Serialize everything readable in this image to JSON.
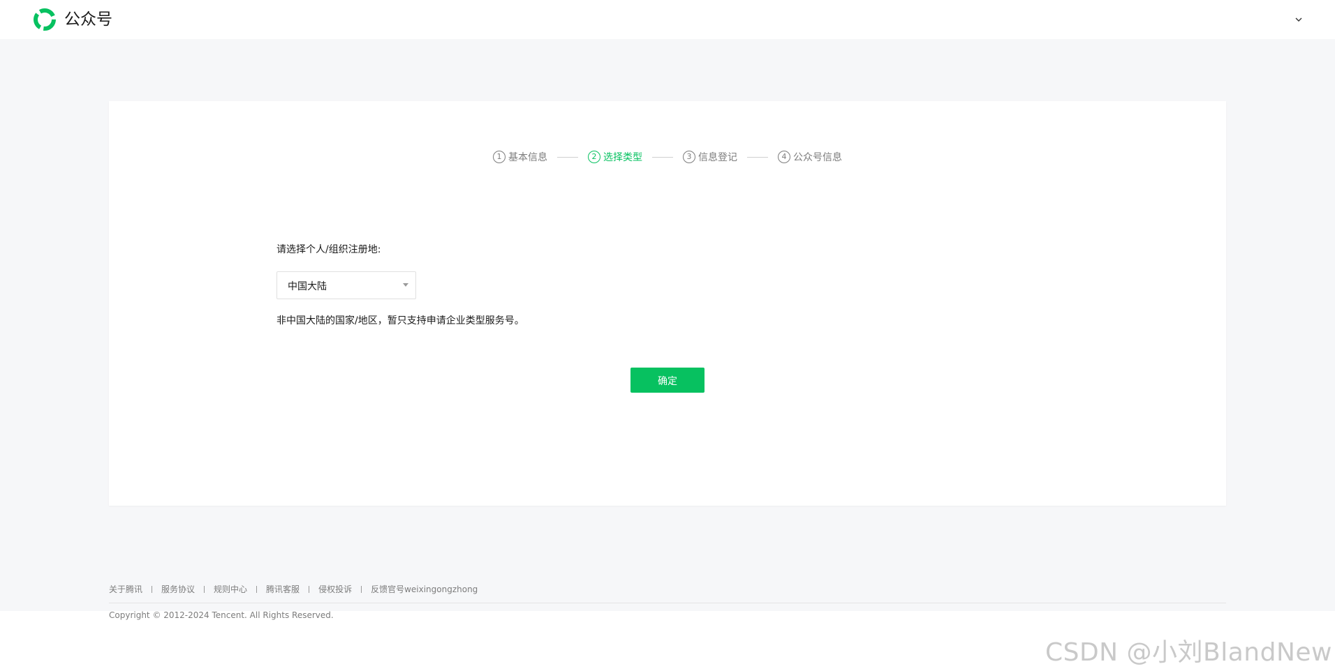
{
  "header": {
    "brand": "公众号",
    "logo_icon": "wechat-official-account-logo-icon",
    "account_menu_icon": "chevron-down-icon"
  },
  "steps": [
    {
      "num": "1",
      "label": "基本信息",
      "active": false
    },
    {
      "num": "2",
      "label": "选择类型",
      "active": true
    },
    {
      "num": "3",
      "label": "信息登记",
      "active": false
    },
    {
      "num": "4",
      "label": "公众号信息",
      "active": false
    }
  ],
  "form": {
    "region_label": "请选择个人/组织注册地:",
    "region_value": "中国大陆",
    "tip": "非中国大陆的国家/地区，暂只支持申请企业类型服务号。",
    "confirm_label": "确定"
  },
  "footer": {
    "links": [
      "关于腾讯",
      "服务协议",
      "规则中心",
      "腾讯客服",
      "侵权投诉",
      "反馈官号weixingongzhong"
    ],
    "copyright": "Copyright © 2012-2024 Tencent. All Rights Reserved."
  },
  "watermark": "CSDN @小刘BlandNew",
  "colors": {
    "accent": "#07c160",
    "page_bg": "#f6f7f9",
    "muted_text": "#7c7c7c"
  }
}
